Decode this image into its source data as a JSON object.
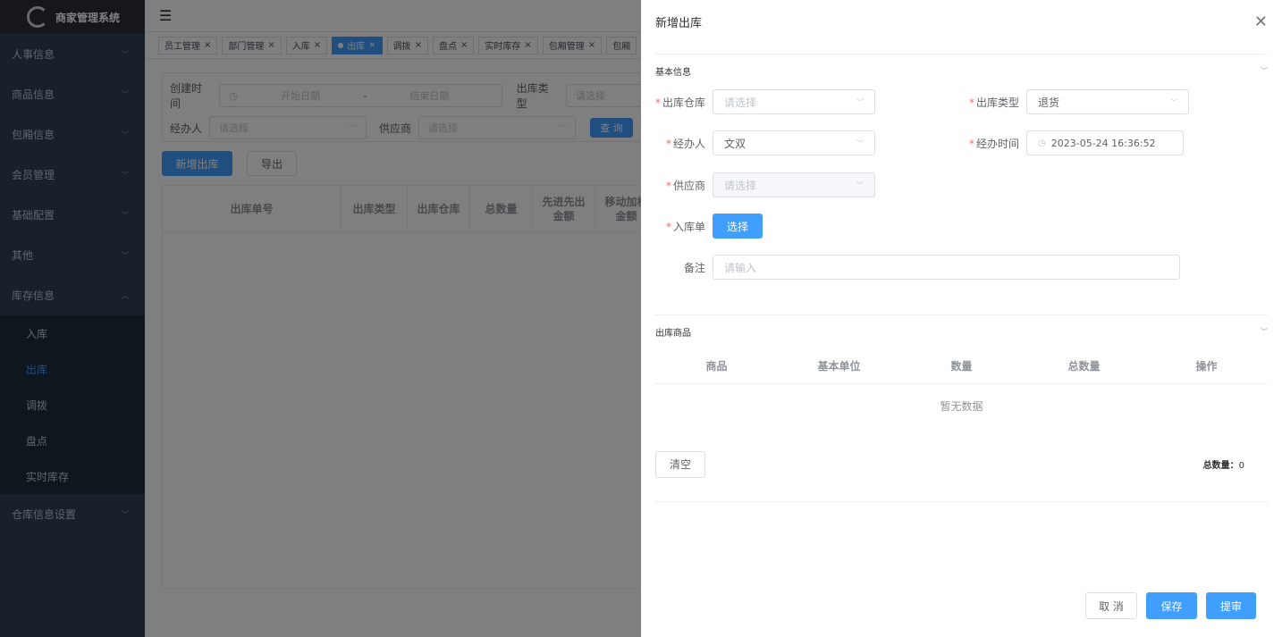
{
  "app": {
    "title": "商家管理系统"
  },
  "sidebar": {
    "items": [
      {
        "label": "人事信息"
      },
      {
        "label": "商品信息"
      },
      {
        "label": "包厢信息"
      },
      {
        "label": "会员管理"
      },
      {
        "label": "基础配置"
      },
      {
        "label": "其他"
      },
      {
        "label": "库存信息"
      }
    ],
    "sub_items": [
      {
        "label": "入库"
      },
      {
        "label": "出库"
      },
      {
        "label": "调拨"
      },
      {
        "label": "盘点"
      },
      {
        "label": "实时库存"
      }
    ],
    "last_item": {
      "label": "仓库信息设置"
    }
  },
  "tags": [
    {
      "label": "员工管理"
    },
    {
      "label": "部门管理"
    },
    {
      "label": "入库"
    },
    {
      "label": "出库"
    },
    {
      "label": "调拨"
    },
    {
      "label": "盘点"
    },
    {
      "label": "实时库存"
    },
    {
      "label": "包厢管理"
    },
    {
      "label": "包厢"
    }
  ],
  "search": {
    "created_label": "创建时间",
    "start_placeholder": "开始日期",
    "separator": "-",
    "end_placeholder": "结束日期",
    "type_label": "出库类型",
    "type_placeholder": "请选择",
    "handler_label": "经办人",
    "handler_placeholder": "请选择",
    "supplier_label": "供应商",
    "supplier_placeholder": "请选择",
    "query_button": "查 询"
  },
  "actions": {
    "add_button": "新增出库",
    "export_button": "导出"
  },
  "table": {
    "headers": [
      "出库单号",
      "出库类型",
      "出库仓库",
      "总数量",
      "先进先出\n金额",
      "移动加权\n金额"
    ]
  },
  "drawer": {
    "title": "新增出库",
    "basic_section": "基本信息",
    "warehouse_label": "出库仓库",
    "warehouse_placeholder": "请选择",
    "type_label": "出库类型",
    "type_value": "退货",
    "handler_label": "经办人",
    "handler_value": "文双",
    "time_label": "经办时间",
    "time_value": "2023-05-24 16:36:52",
    "supplier_label": "供应商",
    "supplier_placeholder": "请选择",
    "receipt_label": "入库单",
    "select_button": "选择",
    "remark_label": "备注",
    "remark_placeholder": "请输入",
    "goods_section": "出库商品",
    "goods_headers": [
      "商品",
      "基本单位",
      "数量",
      "总数量",
      "操作"
    ],
    "empty_text": "暂无数据",
    "clear_button": "清空",
    "total_label": "总数量：",
    "total_value": "0",
    "cancel_button": "取 消",
    "save_button": "保存",
    "submit_button": "提审"
  }
}
